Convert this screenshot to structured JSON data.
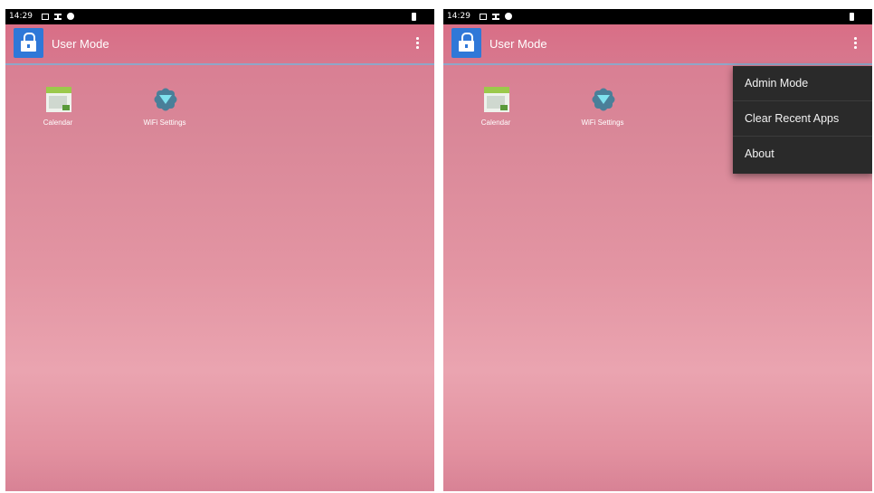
{
  "colors": {
    "status_bar": "#000000",
    "action_bar": "#d7788e",
    "action_bar_divider": "#8fa6c8",
    "app_icon": "#2f78d8",
    "menu_background": "#2a2a2a",
    "menu_text": "#f2f2f2",
    "wallpaper": "#e395a3"
  },
  "screens": [
    {
      "status_bar": {
        "time": "14:29",
        "icons": [
          "notification-icon",
          "list-icon",
          "settings-icon",
          "battery-icon"
        ]
      },
      "action_bar": {
        "title": "User Mode",
        "app_icon": "lock-icon",
        "overflow_icon": "overflow-menu-icon"
      },
      "apps": [
        {
          "label": "Calendar",
          "icon": "calendar-icon"
        },
        {
          "label": "WiFi Settings",
          "icon": "wifi-settings-icon"
        }
      ]
    },
    {
      "status_bar": {
        "time": "14:29",
        "icons": [
          "notification-icon",
          "list-icon",
          "settings-icon",
          "battery-icon"
        ]
      },
      "action_bar": {
        "title": "User Mode",
        "app_icon": "lock-icon",
        "overflow_icon": "overflow-menu-icon"
      },
      "apps": [
        {
          "label": "Calendar",
          "icon": "calendar-icon"
        },
        {
          "label": "WiFi Settings",
          "icon": "wifi-settings-icon"
        }
      ],
      "menu": {
        "items": [
          "Admin Mode",
          "Clear Recent Apps",
          "About"
        ]
      }
    }
  ]
}
